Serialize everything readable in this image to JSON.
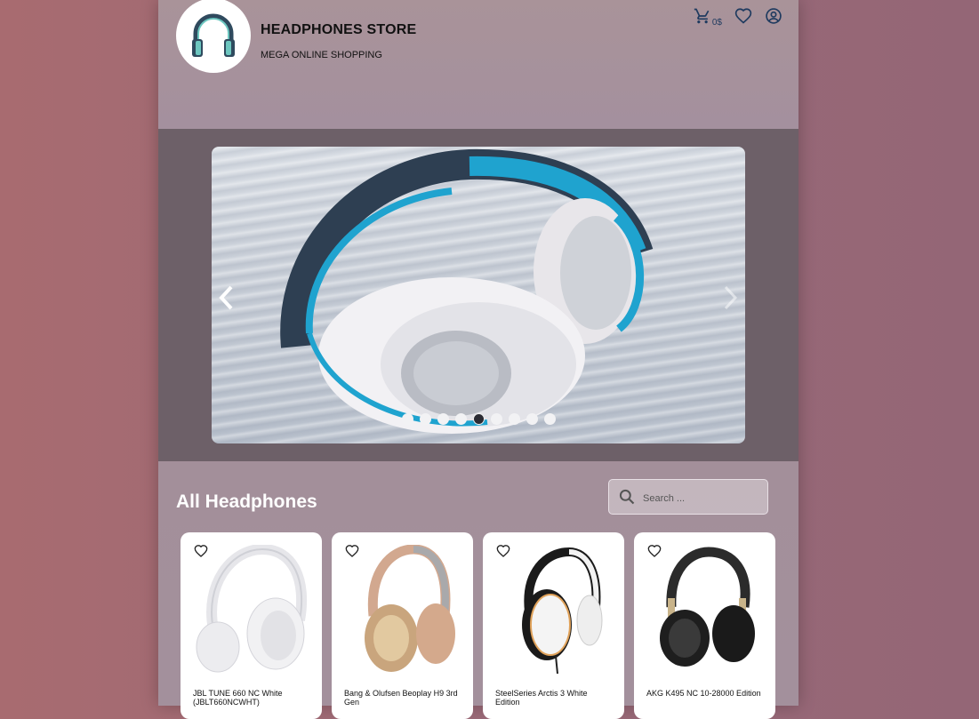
{
  "header": {
    "title": "HEADPHONES STORE",
    "subtitle": "MEGA ONLINE SHOPPING",
    "cart_total": "0$",
    "icons": [
      "cart-icon",
      "heart-icon",
      "account-icon"
    ],
    "accent_color": "#1e3a5f"
  },
  "carousel": {
    "slide_count": 9,
    "active_index": 4
  },
  "products": {
    "title": "All Headphones",
    "search_placeholder": "Search ...",
    "items": [
      {
        "name": "JBL TUNE 660 NC White (JBLT660NCWHT)",
        "color": "white"
      },
      {
        "name": "Bang & Olufsen Beoplay H9 3rd Gen",
        "color": "gold"
      },
      {
        "name": "SteelSeries Arctis 3 White Edition",
        "color": "white-black"
      },
      {
        "name": "AKG K495 NC 10-28000 Edition",
        "color": "black"
      }
    ]
  }
}
